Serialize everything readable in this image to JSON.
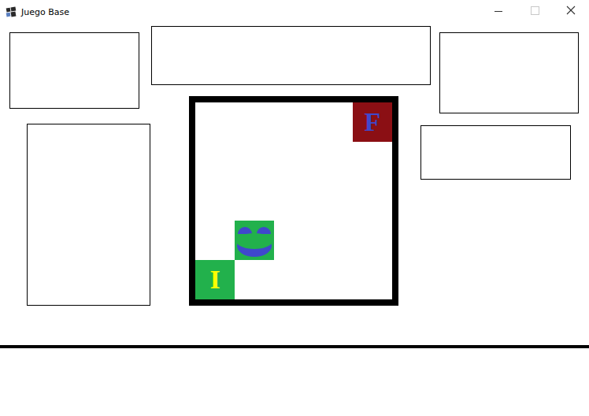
{
  "window": {
    "title": "Juego Base"
  },
  "board": {
    "rows": 5,
    "cols": 5,
    "tiles": [
      {
        "label": "I",
        "kind": "start",
        "row": 4,
        "col": 0,
        "color": "#22b14c",
        "text_color": "#ffff00"
      },
      {
        "label": "F",
        "kind": "goal",
        "row": 0,
        "col": 4,
        "color": "#8b0f14",
        "text_color": "#3f48cc"
      }
    ],
    "player": {
      "row": 3,
      "col": 1
    }
  }
}
